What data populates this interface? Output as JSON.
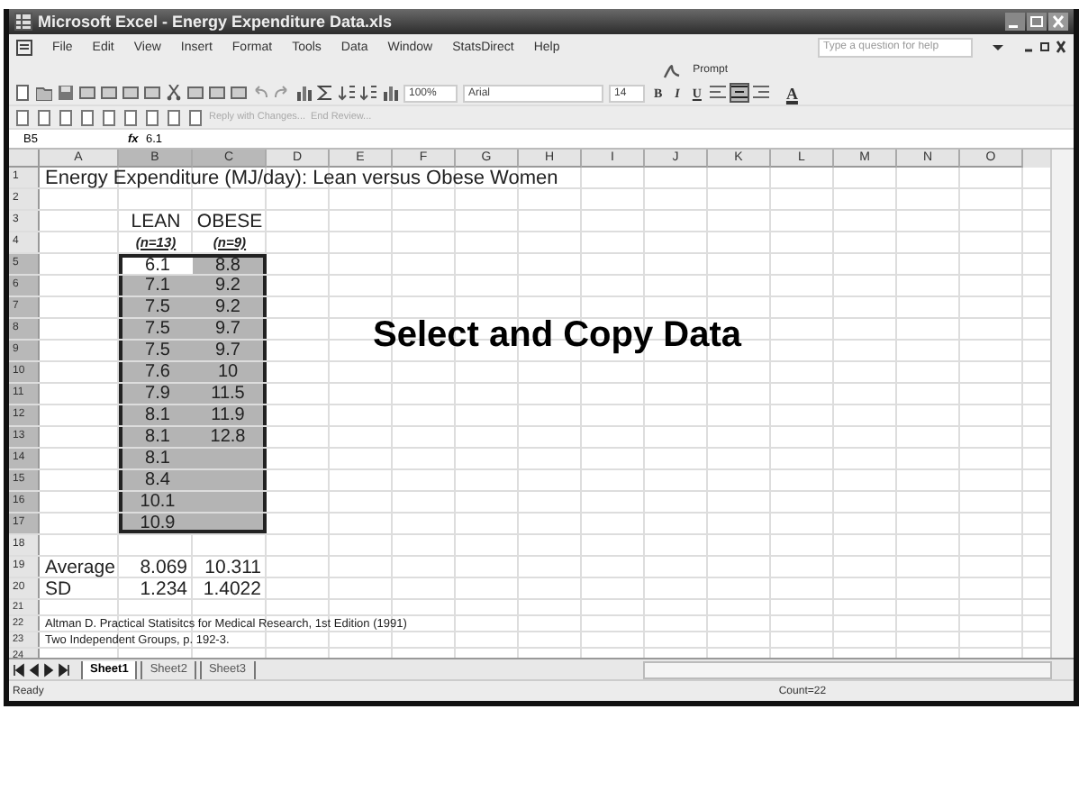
{
  "window": {
    "title": "Microsoft Excel - Energy Expenditure Data.xls"
  },
  "menu": [
    "File",
    "Edit",
    "View",
    "Insert",
    "Format",
    "Tools",
    "Data",
    "Window",
    "StatsDirect",
    "Help"
  ],
  "help_field": {
    "placeholder": "Type a question for help"
  },
  "prompt_button": "Prompt",
  "toolbar": {
    "zoom": "100%",
    "font": "Arial",
    "font_size": "14",
    "format_buttons": [
      "B",
      "I",
      "U"
    ],
    "font_color_button": "A"
  },
  "review_toolbar": {
    "reply": "Reply with Changes...",
    "end_review": "End Review..."
  },
  "formula_bar": {
    "name_box": "B5",
    "fx_label": "fx",
    "formula": "6.1"
  },
  "columns": [
    {
      "label": "A",
      "selected": false
    },
    {
      "label": "B",
      "selected": true
    },
    {
      "label": "C",
      "selected": true
    },
    {
      "label": "D",
      "selected": false
    },
    {
      "label": "E",
      "selected": false
    },
    {
      "label": "F",
      "selected": false
    },
    {
      "label": "G",
      "selected": false
    },
    {
      "label": "H",
      "selected": false
    },
    {
      "label": "I",
      "selected": false
    },
    {
      "label": "J",
      "selected": false
    },
    {
      "label": "K",
      "selected": false
    },
    {
      "label": "L",
      "selected": false
    },
    {
      "label": "M",
      "selected": false
    },
    {
      "label": "N",
      "selected": false
    },
    {
      "label": "O",
      "selected": false
    }
  ],
  "rows": [
    {
      "num": "1",
      "kind": "title",
      "selected": false,
      "text": "Energy Expenditure (MJ/day): Lean versus Obese Women"
    },
    {
      "num": "2",
      "kind": "blank",
      "selected": false
    },
    {
      "num": "3",
      "kind": "header",
      "selected": false,
      "cells": [
        {},
        {
          "text": "LEAN"
        },
        {
          "text": "OBESE"
        }
      ]
    },
    {
      "num": "4",
      "kind": "subheader",
      "selected": false,
      "cells": [
        {},
        {
          "text": "(n=13)"
        },
        {
          "text": "(n=9)"
        }
      ]
    },
    {
      "num": "5",
      "kind": "data",
      "selected": true,
      "cells": [
        {},
        {
          "text": "6.1",
          "selected": true,
          "active": true
        },
        {
          "text": "8.8",
          "selected": true,
          "active": false
        }
      ]
    },
    {
      "num": "6",
      "kind": "data",
      "selected": true,
      "cells": [
        {},
        {
          "text": "7.1",
          "selected": true,
          "active": false
        },
        {
          "text": "9.2",
          "selected": true,
          "active": false
        }
      ]
    },
    {
      "num": "7",
      "kind": "data",
      "selected": true,
      "cells": [
        {},
        {
          "text": "7.5",
          "selected": true,
          "active": false
        },
        {
          "text": "9.2",
          "selected": true,
          "active": false
        }
      ]
    },
    {
      "num": "8",
      "kind": "data",
      "selected": true,
      "cells": [
        {},
        {
          "text": "7.5",
          "selected": true,
          "active": false
        },
        {
          "text": "9.7",
          "selected": true,
          "active": false
        }
      ]
    },
    {
      "num": "9",
      "kind": "data",
      "selected": true,
      "cells": [
        {},
        {
          "text": "7.5",
          "selected": true,
          "active": false
        },
        {
          "text": "9.7",
          "selected": true,
          "active": false
        }
      ]
    },
    {
      "num": "10",
      "kind": "data",
      "selected": true,
      "cells": [
        {},
        {
          "text": "7.6",
          "selected": true,
          "active": false
        },
        {
          "text": "10",
          "selected": true,
          "active": false
        }
      ]
    },
    {
      "num": "11",
      "kind": "data",
      "selected": true,
      "cells": [
        {},
        {
          "text": "7.9",
          "selected": true,
          "active": false
        },
        {
          "text": "11.5",
          "selected": true,
          "active": false
        }
      ]
    },
    {
      "num": "12",
      "kind": "data",
      "selected": true,
      "cells": [
        {},
        {
          "text": "8.1",
          "selected": true,
          "active": false
        },
        {
          "text": "11.9",
          "selected": true,
          "active": false
        }
      ]
    },
    {
      "num": "13",
      "kind": "data",
      "selected": true,
      "cells": [
        {},
        {
          "text": "8.1",
          "selected": true,
          "active": false
        },
        {
          "text": "12.8",
          "selected": true,
          "active": false
        }
      ]
    },
    {
      "num": "14",
      "kind": "data",
      "selected": true,
      "cells": [
        {},
        {
          "text": "8.1",
          "selected": true,
          "active": false
        },
        {
          "selected": true,
          "active": false
        }
      ]
    },
    {
      "num": "15",
      "kind": "data",
      "selected": true,
      "cells": [
        {},
        {
          "text": "8.4",
          "selected": true,
          "active": false
        },
        {
          "selected": true,
          "active": false
        }
      ]
    },
    {
      "num": "16",
      "kind": "data",
      "selected": true,
      "cells": [
        {},
        {
          "text": "10.1",
          "selected": true,
          "active": false
        },
        {
          "selected": true,
          "active": false
        }
      ]
    },
    {
      "num": "17",
      "kind": "data",
      "selected": true,
      "cells": [
        {},
        {
          "text": "10.9",
          "selected": true,
          "active": false
        },
        {
          "selected": true,
          "active": false
        }
      ]
    },
    {
      "num": "18",
      "kind": "blank",
      "selected": false
    },
    {
      "num": "19",
      "kind": "stat",
      "selected": false,
      "cells": [
        {
          "text": "Average"
        },
        {
          "text": "8.069"
        },
        {
          "text": "10.311"
        }
      ]
    },
    {
      "num": "20",
      "kind": "stat",
      "selected": false,
      "cells": [
        {
          "text": "SD"
        },
        {
          "text": "1.234"
        },
        {
          "text": "1.4022"
        }
      ]
    },
    {
      "num": "21",
      "kind": "small",
      "selected": false
    },
    {
      "num": "22",
      "kind": "note",
      "selected": false,
      "text": "Altman D. Practical Statisitcs for Medical Research, 1st Edition (1991)"
    },
    {
      "num": "23",
      "kind": "note",
      "selected": false,
      "text": "Two Independent Groups, p. 192-3."
    },
    {
      "num": "24",
      "kind": "small",
      "selected": false
    }
  ],
  "overlay_text": "Select and Copy Data",
  "sheet_tabs": [
    {
      "label": "Sheet1",
      "selected": true
    },
    {
      "label": "Sheet2",
      "selected": false
    },
    {
      "label": "Sheet3",
      "selected": false
    }
  ],
  "status_bar": {
    "state": "Ready",
    "summary": "Count=22"
  }
}
